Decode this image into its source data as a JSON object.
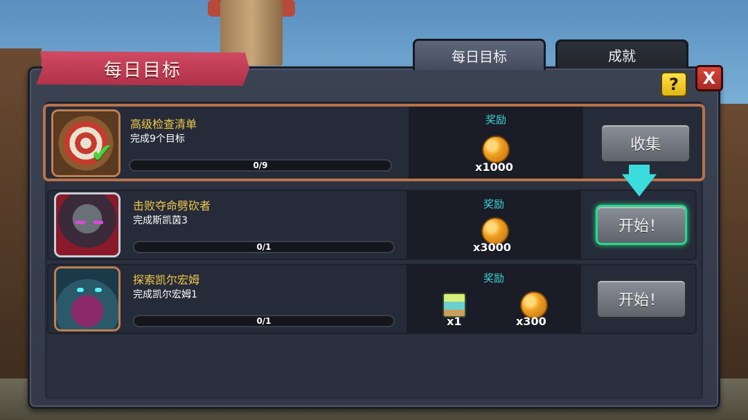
{
  "header": {
    "title": "每日目标",
    "tabs": [
      {
        "label": "每日目标",
        "active": true
      },
      {
        "label": "成就",
        "active": false
      }
    ],
    "help_label": "?",
    "close_label": "X"
  },
  "quests": [
    {
      "title": "高级检查清单",
      "subtitle": "完成9个目标",
      "progress_text": "0/9",
      "progress_fraction": 0,
      "reward_label": "奖励",
      "rewards": [
        {
          "icon": "gold-coin-icon",
          "qty": "x1000"
        }
      ],
      "button_label": "收集",
      "portrait": "target-icon"
    },
    {
      "title": "击败夺命劈砍者",
      "subtitle": "完成斯凯茵3",
      "progress_text": "0/1",
      "progress_fraction": 0,
      "reward_label": "奖励",
      "rewards": [
        {
          "icon": "gold-coin-icon",
          "qty": "x3000"
        }
      ],
      "button_label": "开始！",
      "portrait": "knight-portrait"
    },
    {
      "title": "探索凯尔宏姆",
      "subtitle": "完成凯尔宏姆1",
      "progress_text": "0/1",
      "progress_fraction": 0,
      "reward_label": "奖励",
      "rewards": [
        {
          "icon": "potion-icon",
          "qty": "x1"
        },
        {
          "icon": "gold-coin-icon",
          "qty": "x300"
        }
      ],
      "button_label": "开始！",
      "portrait": "monster-portrait"
    }
  ],
  "colors": {
    "accent_cyan": "#3adcdc",
    "title_gold": "#f2c94a",
    "ribbon_red": "#c03a54",
    "highlight_green": "#2ad88a"
  }
}
